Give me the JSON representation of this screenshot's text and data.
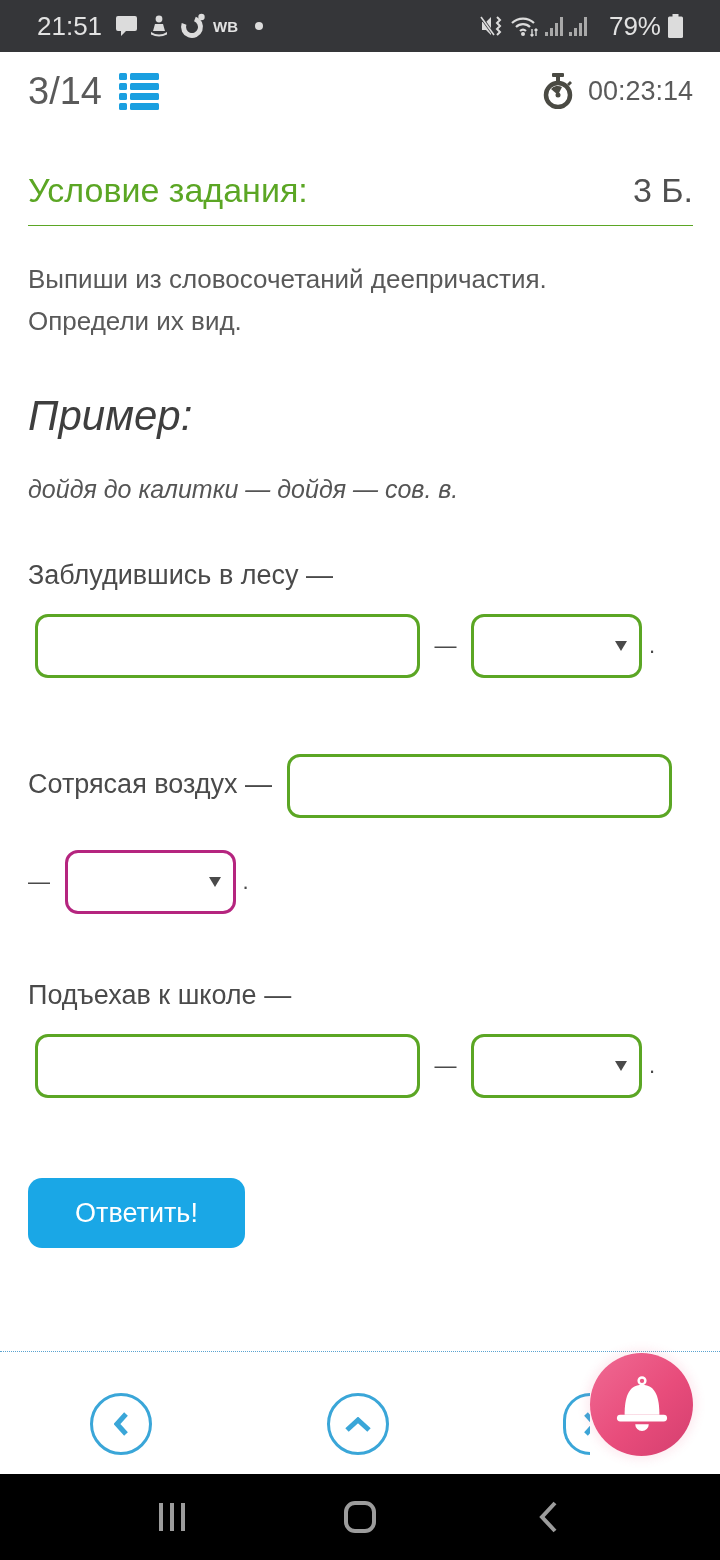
{
  "status_bar": {
    "time": "21:51",
    "app_label": "WB",
    "battery": "79%"
  },
  "header": {
    "progress": "3/14",
    "timer": "00:23:14"
  },
  "task": {
    "title": "Условие задания:",
    "points": "3 Б.",
    "instruction": [
      "Выпиши из словосочетаний деепричастия.",
      "Определи их вид."
    ]
  },
  "example": {
    "heading": "Пример:",
    "text": "дойдя до калитки — дойдя — сов. в."
  },
  "items": [
    {
      "phrase": "Заблудившись в лесу —",
      "separator": "—",
      "dropdown": {
        "highlighted": false
      },
      "end": "."
    },
    {
      "phrase": "Сотрясая воздух —",
      "separator": "—",
      "dropdown": {
        "highlighted": true
      },
      "end": "."
    },
    {
      "phrase": "Подъехав к школе —",
      "separator": "—",
      "dropdown": {
        "highlighted": false
      },
      "end": "."
    }
  ],
  "submit_button": "Ответить!"
}
